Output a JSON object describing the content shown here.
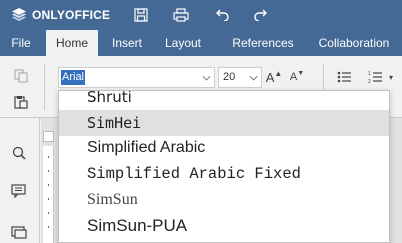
{
  "app": {
    "logo_text": "ONLYOFFICE"
  },
  "titlebar": {
    "icons": [
      "save-icon",
      "print-icon",
      "undo-icon",
      "redo-icon"
    ]
  },
  "tabs": [
    {
      "label": "File"
    },
    {
      "label": "Home"
    },
    {
      "label": "Insert"
    },
    {
      "label": "Layout"
    },
    {
      "label": "References"
    },
    {
      "label": "Collaboration"
    }
  ],
  "toolbar": {
    "font_name": "Arial",
    "font_size": "20",
    "increase_font_glyph": "A",
    "decrease_font_glyph": "A"
  },
  "font_list": {
    "items": [
      {
        "label": "Shruti"
      },
      {
        "label": "SimHei"
      },
      {
        "label": "Simplified Arabic"
      },
      {
        "label": "Simplified Arabic Fixed"
      },
      {
        "label": "SimSun"
      },
      {
        "label": "SimSun-PUA"
      }
    ],
    "selected_index": 1
  },
  "colors": {
    "brand": "#446995",
    "selection": "#3470bd",
    "hover": "#e0e0e0"
  }
}
